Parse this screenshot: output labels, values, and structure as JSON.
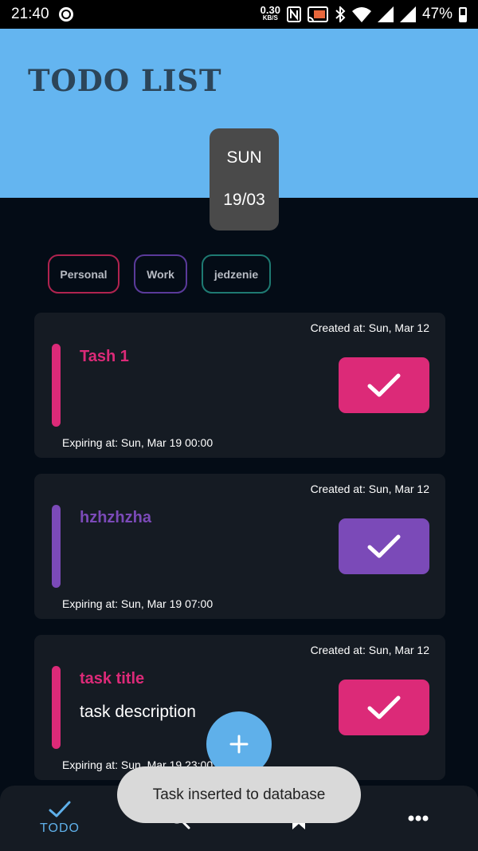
{
  "status_bar": {
    "time": "21:40",
    "net_speed_value": "0.30",
    "net_speed_unit": "KB/S",
    "battery": "47%"
  },
  "header": {
    "title": "TODO LIST",
    "date_day": "SUN",
    "date_num": "19/03",
    "background_color": "#64b5f0"
  },
  "categories": [
    {
      "label": "Personal",
      "color": "#b0234f"
    },
    {
      "label": "Work",
      "color": "#5a3a9a"
    },
    {
      "label": "jedzenie",
      "color": "#1e7a72"
    }
  ],
  "tasks": [
    {
      "created": "Created at: Sun, Mar 12",
      "title": "Tash 1",
      "description": "",
      "expiring": "Expiring at: Sun, Mar 19 00:00",
      "color": "#dc2a78",
      "icon": "check-icon"
    },
    {
      "created": "Created at: Sun, Mar 12",
      "title": "hzhzhzha",
      "description": "",
      "expiring": "Expiring at: Sun, Mar 19 07:00",
      "color": "#7b4ab8",
      "icon": "check-icon"
    },
    {
      "created": "Created at: Sun, Mar 12",
      "title": "task title",
      "description": "task description",
      "expiring": "Expiring at: Sun, Mar 19 23:00",
      "color": "#dc2a78",
      "icon": "check-icon"
    }
  ],
  "bottom_nav": {
    "todo_label": "TODO",
    "accent_color": "#5fb0ea"
  },
  "fab": {
    "icon": "plus-icon"
  },
  "toast": {
    "message": "Task inserted to database"
  }
}
